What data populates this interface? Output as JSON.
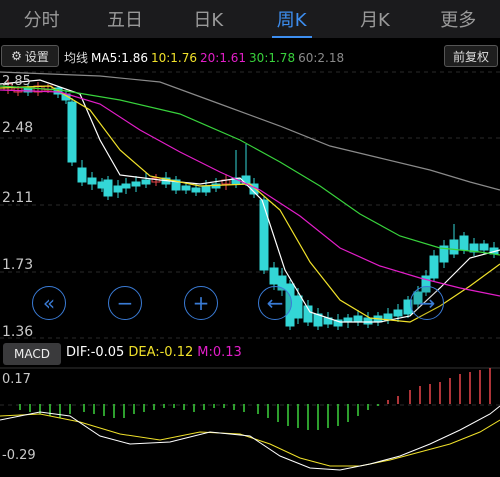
{
  "tabs": [
    {
      "label": "分时"
    },
    {
      "label": "五日"
    },
    {
      "label": "日K"
    },
    {
      "label": "周K"
    },
    {
      "label": "月K"
    },
    {
      "label": "更多"
    }
  ],
  "active_tab": "周K",
  "settings_label": "设置",
  "adjust_label": "前复权",
  "ma": {
    "prefix": "均线",
    "ma5": "MA5:1.86",
    "ma10": "10:1.76",
    "ma20": "20:1.61",
    "ma30": "30:1.78",
    "ma60": "60:2.18"
  },
  "price_axis": [
    "2.85",
    "2.48",
    "2.11",
    "1.73",
    "1.36"
  ],
  "macd": {
    "label": "MACD",
    "dif": "DIF:-0.05",
    "dea": "DEA:-0.12",
    "m": "M:0.13",
    "axis_top": "0.17",
    "axis_bottom": "-0.29"
  },
  "colors": {
    "up": "#e8464a",
    "down": "#33d6d6",
    "ma5": "#ffffff",
    "ma10": "#f0e12a",
    "ma20": "#e21ec8",
    "ma30": "#38d23c",
    "ma60": "#8a8a8a",
    "accent": "#3d8ef0"
  },
  "controls": [
    "rewind-icon",
    "zoom-out-icon",
    "zoom-in-icon",
    "back-icon",
    "forward-icon"
  ]
}
